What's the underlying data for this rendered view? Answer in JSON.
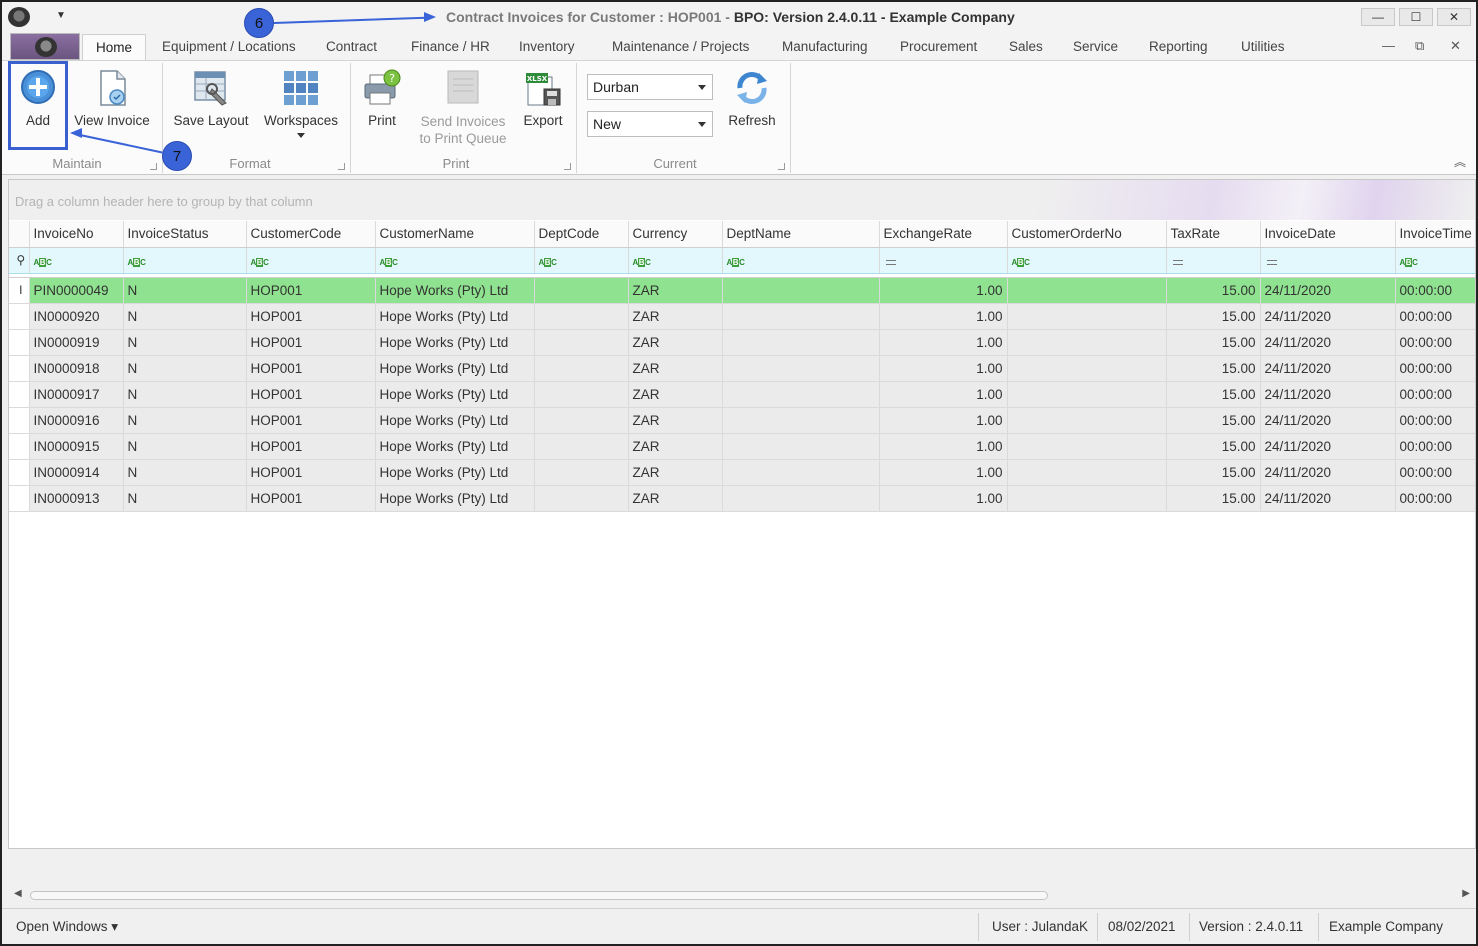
{
  "window": {
    "title_prefix": "Contract Invoices for Customer : HOP001 - ",
    "title_main": "BPO: Version 2.4.0.11 - Example Company",
    "controls": {
      "minimize": "—",
      "restore": "☐",
      "close": "✕"
    }
  },
  "tabs": [
    {
      "label": "Home",
      "active": true
    },
    {
      "label": "Equipment / Locations"
    },
    {
      "label": "Contract"
    },
    {
      "label": "Finance / HR"
    },
    {
      "label": "Inventory"
    },
    {
      "label": "Maintenance / Projects"
    },
    {
      "label": "Manufacturing"
    },
    {
      "label": "Procurement"
    },
    {
      "label": "Sales"
    },
    {
      "label": "Service"
    },
    {
      "label": "Reporting"
    },
    {
      "label": "Utilities"
    }
  ],
  "ribbon": {
    "add": "Add",
    "view_invoice": "View Invoice",
    "save_layout": "Save Layout",
    "workspaces": "Workspaces",
    "print": "Print",
    "send_invoices_line1": "Send Invoices",
    "send_invoices_line2": "to Print Queue",
    "export": "Export",
    "refresh": "Refresh",
    "site_value": "Durban",
    "status_value": "New",
    "groups": {
      "maintain": "Maintain",
      "format": "Format",
      "print": "Print",
      "current": "Current"
    },
    "accent_color": "#3a5fcf"
  },
  "grid": {
    "group_panel_hint": "Drag a column header here to group by that column",
    "columns": [
      "InvoiceNo",
      "InvoiceStatus",
      "CustomerCode",
      "CustomerName",
      "DeptCode",
      "Currency",
      "DeptName",
      "ExchangeRate",
      "CustomerOrderNo",
      "TaxRate",
      "InvoiceDate",
      "InvoiceTime"
    ],
    "rows": [
      {
        "InvoiceNo": "PIN0000049",
        "InvoiceStatus": "N",
        "CustomerCode": "HOP001",
        "CustomerName": "Hope Works (Pty) Ltd",
        "DeptCode": "",
        "Currency": "ZAR",
        "DeptName": "",
        "ExchangeRate": "1.00",
        "CustomerOrderNo": "",
        "TaxRate": "15.00",
        "InvoiceDate": "24/11/2020",
        "InvoiceTime": "00:00:00",
        "selected": true
      },
      {
        "InvoiceNo": "IN0000920",
        "InvoiceStatus": "N",
        "CustomerCode": "HOP001",
        "CustomerName": "Hope Works (Pty) Ltd",
        "DeptCode": "",
        "Currency": "ZAR",
        "DeptName": "",
        "ExchangeRate": "1.00",
        "CustomerOrderNo": "",
        "TaxRate": "15.00",
        "InvoiceDate": "24/11/2020",
        "InvoiceTime": "00:00:00"
      },
      {
        "InvoiceNo": "IN0000919",
        "InvoiceStatus": "N",
        "CustomerCode": "HOP001",
        "CustomerName": "Hope Works (Pty) Ltd",
        "DeptCode": "",
        "Currency": "ZAR",
        "DeptName": "",
        "ExchangeRate": "1.00",
        "CustomerOrderNo": "",
        "TaxRate": "15.00",
        "InvoiceDate": "24/11/2020",
        "InvoiceTime": "00:00:00"
      },
      {
        "InvoiceNo": "IN0000918",
        "InvoiceStatus": "N",
        "CustomerCode": "HOP001",
        "CustomerName": "Hope Works (Pty) Ltd",
        "DeptCode": "",
        "Currency": "ZAR",
        "DeptName": "",
        "ExchangeRate": "1.00",
        "CustomerOrderNo": "",
        "TaxRate": "15.00",
        "InvoiceDate": "24/11/2020",
        "InvoiceTime": "00:00:00"
      },
      {
        "InvoiceNo": "IN0000917",
        "InvoiceStatus": "N",
        "CustomerCode": "HOP001",
        "CustomerName": "Hope Works (Pty) Ltd",
        "DeptCode": "",
        "Currency": "ZAR",
        "DeptName": "",
        "ExchangeRate": "1.00",
        "CustomerOrderNo": "",
        "TaxRate": "15.00",
        "InvoiceDate": "24/11/2020",
        "InvoiceTime": "00:00:00"
      },
      {
        "InvoiceNo": "IN0000916",
        "InvoiceStatus": "N",
        "CustomerCode": "HOP001",
        "CustomerName": "Hope Works (Pty) Ltd",
        "DeptCode": "",
        "Currency": "ZAR",
        "DeptName": "",
        "ExchangeRate": "1.00",
        "CustomerOrderNo": "",
        "TaxRate": "15.00",
        "InvoiceDate": "24/11/2020",
        "InvoiceTime": "00:00:00"
      },
      {
        "InvoiceNo": "IN0000915",
        "InvoiceStatus": "N",
        "CustomerCode": "HOP001",
        "CustomerName": "Hope Works (Pty) Ltd",
        "DeptCode": "",
        "Currency": "ZAR",
        "DeptName": "",
        "ExchangeRate": "1.00",
        "CustomerOrderNo": "",
        "TaxRate": "15.00",
        "InvoiceDate": "24/11/2020",
        "InvoiceTime": "00:00:00"
      },
      {
        "InvoiceNo": "IN0000914",
        "InvoiceStatus": "N",
        "CustomerCode": "HOP001",
        "CustomerName": "Hope Works (Pty) Ltd",
        "DeptCode": "",
        "Currency": "ZAR",
        "DeptName": "",
        "ExchangeRate": "1.00",
        "CustomerOrderNo": "",
        "TaxRate": "15.00",
        "InvoiceDate": "24/11/2020",
        "InvoiceTime": "00:00:00"
      },
      {
        "InvoiceNo": "IN0000913",
        "InvoiceStatus": "N",
        "CustomerCode": "HOP001",
        "CustomerName": "Hope Works (Pty) Ltd",
        "DeptCode": "",
        "Currency": "ZAR",
        "DeptName": "",
        "ExchangeRate": "1.00",
        "CustomerOrderNo": "",
        "TaxRate": "15.00",
        "InvoiceDate": "24/11/2020",
        "InvoiceTime": "00:00:00"
      }
    ],
    "selected_row_color": "#8fe28f",
    "filter_row_color": "#e3f8fc"
  },
  "statusbar": {
    "open_windows": "Open Windows ▾",
    "user": "User : JulandaK",
    "date": "08/02/2021",
    "version": "Version : 2.4.0.11",
    "company": "Example Company"
  },
  "annotations": [
    {
      "number": "6"
    },
    {
      "number": "7"
    }
  ]
}
